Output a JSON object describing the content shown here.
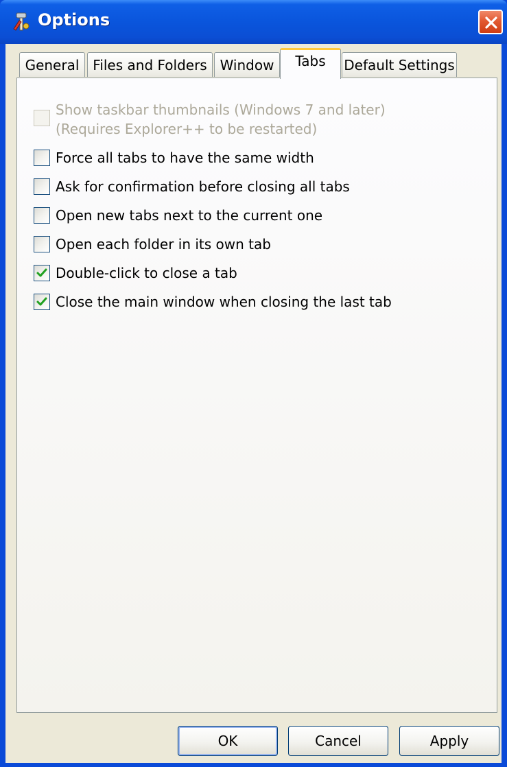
{
  "window": {
    "title": "Options",
    "icon": "options-tools-icon"
  },
  "tabs": [
    {
      "label": "General"
    },
    {
      "label": "Files and Folders"
    },
    {
      "label": "Window"
    },
    {
      "label": "Tabs",
      "active": true
    },
    {
      "label": "Default Settings"
    }
  ],
  "options": [
    {
      "label_line1": "Show taskbar thumbnails (Windows 7 and later)",
      "label_line2": "(Requires Explorer++ to be restarted)",
      "checked": false,
      "enabled": false
    },
    {
      "label": "Force all tabs to have the same width",
      "checked": false,
      "enabled": true
    },
    {
      "label": "Ask for confirmation before closing all tabs",
      "checked": false,
      "enabled": true
    },
    {
      "label": "Open new tabs next to the current one",
      "checked": false,
      "enabled": true
    },
    {
      "label": "Open each folder in its own tab",
      "checked": false,
      "enabled": true
    },
    {
      "label": "Double-click to close a tab",
      "checked": true,
      "enabled": true
    },
    {
      "label": "Close the main window when closing the last tab",
      "checked": true,
      "enabled": true
    }
  ],
  "buttons": {
    "ok": "OK",
    "cancel": "Cancel",
    "apply": "Apply"
  },
  "colors": {
    "titlebar": "#0a55dc",
    "close_button": "#e25a32",
    "active_tab_accent": "#ffc83c",
    "checkmark": "#21a121",
    "dialog_face": "#ece9d8"
  }
}
